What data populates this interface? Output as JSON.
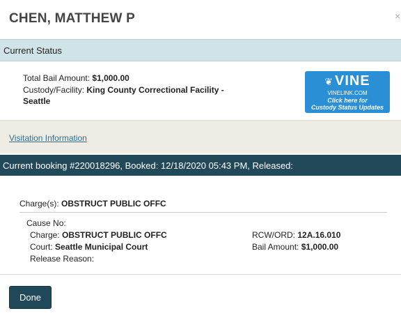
{
  "header": {
    "title": "CHEN, MATTHEW P",
    "close_glyph": "×"
  },
  "current_status": {
    "heading": "Current Status",
    "bail_label": "Total Bail Amount:",
    "bail_value": "$1,000.00",
    "facility_label": "Custody/Facility:",
    "facility_value_line1": "King County Correctional Facility -",
    "facility_value_line2": "Seattle"
  },
  "vine": {
    "logo": "VINE",
    "url": "VINELINK.COM",
    "line1": "Click here for",
    "line2": "Custody Status Updates",
    "color": "#2a8fd4"
  },
  "visitation": {
    "link": "Visitation Information"
  },
  "booking": {
    "header": "Current booking #220018296, Booked: 12/18/2020 05:43 PM, Released:"
  },
  "charges": {
    "label": "Charge(s):",
    "value": "OBSTRUCT PUBLIC OFFC",
    "cause_no_label": "Cause No:",
    "charge_label": "Charge:",
    "charge_value": "OBSTRUCT PUBLIC OFFC",
    "court_label": "Court:",
    "court_value": "Seattle Municipal Court",
    "release_label": "Release Reason:",
    "rcw_label": "RCW/ORD:",
    "rcw_value": "12A.16.010",
    "bail_label": "Bail Amount:",
    "bail_value": "$1,000.00"
  },
  "footer": {
    "done_label": "Done"
  },
  "colors": {
    "status_header": "#d0e3e7",
    "booking_header": "#22495a",
    "visitation_bg": "#efede3",
    "link": "#2d6f8e"
  }
}
